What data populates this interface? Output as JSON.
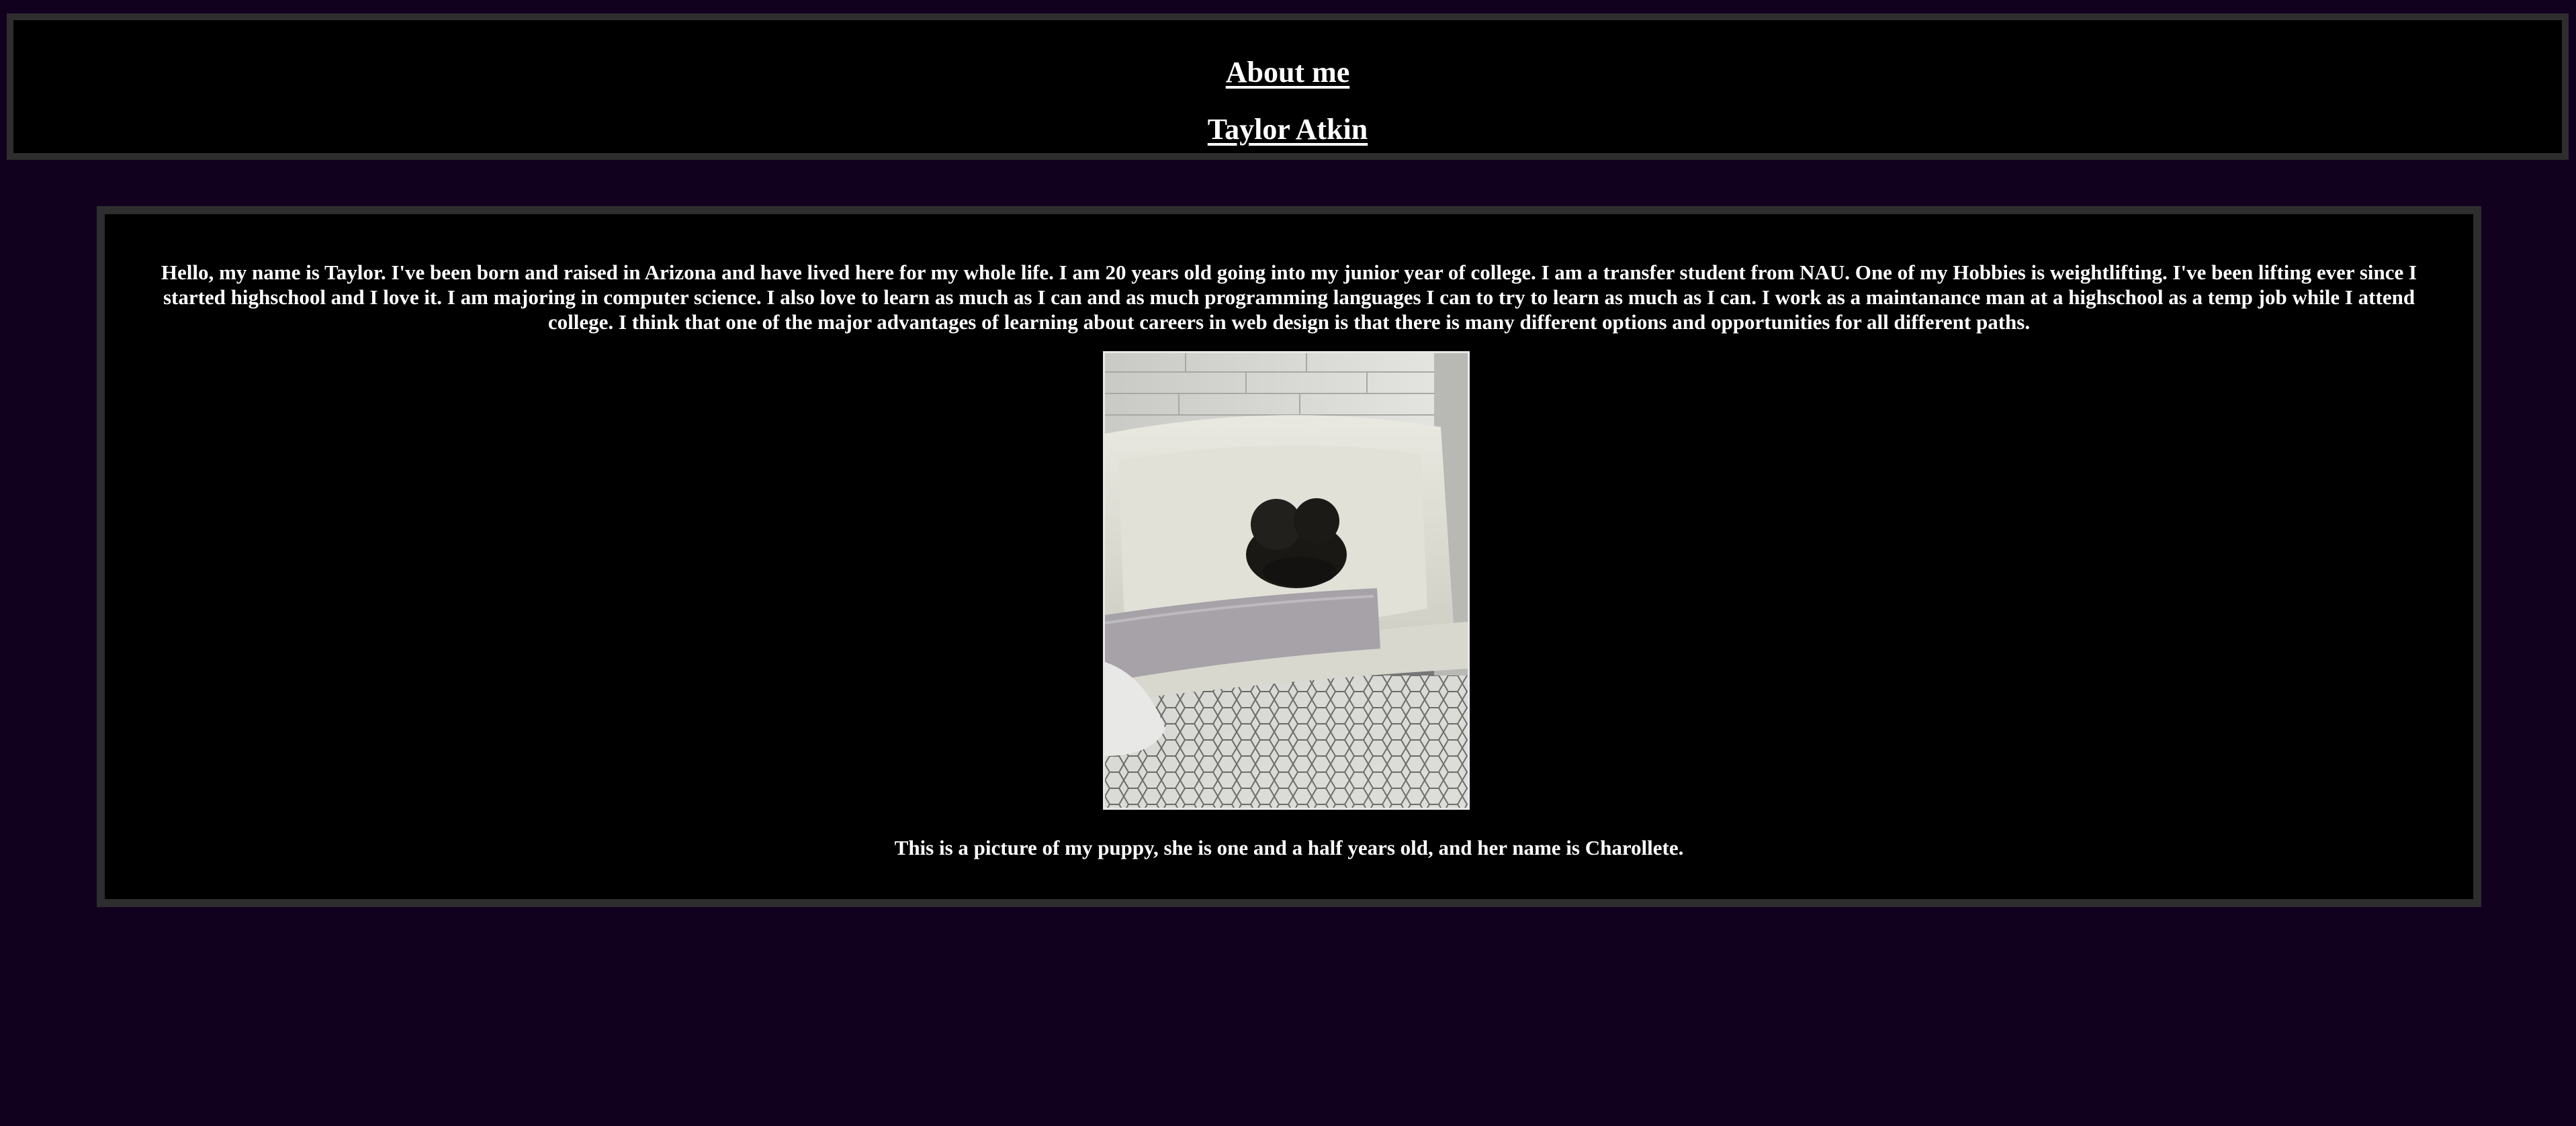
{
  "header": {
    "title": "About me",
    "name": "Taylor Atkin"
  },
  "main": {
    "intro": "Hello, my name is Taylor. I've been born and raised in Arizona and have lived here for my whole life. I am 20 years old going into my junior year of college. I am a transfer student from NAU. One of my Hobbies is weightlifting. I've been lifting ever since I started highschool and I love it. I am majoring in computer science. I also love to learn as much as I can and as much programming languages I can to try to learn as much as I can. I work as a maintanance man at a highschool as a temp job while I attend college. I think that one of the major advantages of learning about careers in web design is that there is many different options and opportunities for all different paths.",
    "photo_alt": "Small black puppy in a white bathtub",
    "caption": "This is a picture of my puppy, she is one and a half years old, and her name is Charollete."
  },
  "colors": {
    "page_background": "#12001f",
    "panel_background": "#000000",
    "panel_border": "#2e2e2e",
    "text": "#ffffff"
  }
}
